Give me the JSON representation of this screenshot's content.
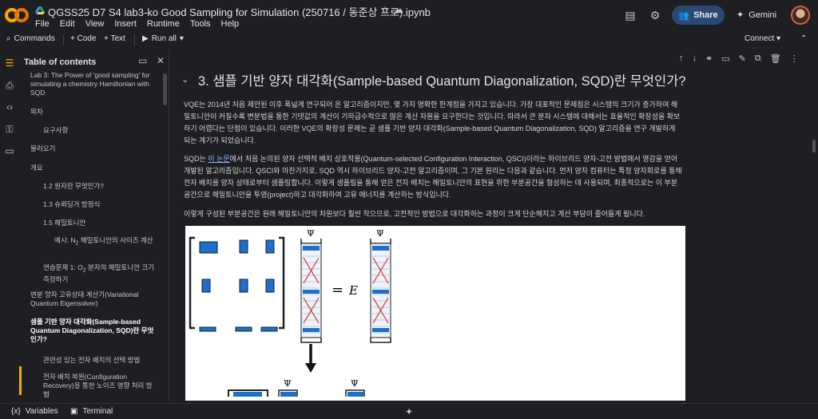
{
  "app": {
    "title": "QGSS25 D7 S4 lab3-ko Good Sampling for Simulation (250716 / 동준상 프로).ipynb",
    "menu": [
      "File",
      "Edit",
      "View",
      "Insert",
      "Runtime",
      "Tools",
      "Help"
    ],
    "share_label": "Share",
    "gemini_label": "Gemini"
  },
  "toolbar": {
    "commands": "Commands",
    "code": "+ Code",
    "text": "+ Text",
    "run_all": "Run all",
    "connect": "Connect"
  },
  "toc": {
    "title": "Table of contents",
    "items": [
      "Lab 3: The Power of 'good sampling' for simulating a chemistry Hamiltonian with SQD",
      "목차",
      "요구사항",
      "불러오기",
      "개요",
      "1.2 원자란 무엇인가?",
      "1.3 슈뢰딩거 방정식",
      "1.5 해밀토니안",
      "예시: N",
      "2",
      "해밀토니안의 사이즈 계산",
      "연습문제 1: O",
      "2",
      "분자의 해밀토니안 크기 측정하기",
      "변분 양자 고유상태 계산기(Variational Quantum Eigensolver)",
      "샘플 기반 양자 대각화(Sample-based Quantum Diagonalization, SQD)란 무엇인가?",
      "관련성 있는 전자 배치의 선택 방법",
      "전자 배치 복원(Configuration Recovery)을 통한 노이즈 영향 처리 방법"
    ]
  },
  "notebook": {
    "heading": "3. 샘플 기반 양자 대각화(Sample-based Quantum Diagonalization, SQD)란 무엇인가?",
    "p1": "VQE는 2014년 처음 제안된 이후 폭넓게 연구되어 온 알고리즘이지만, 몇 가지 명확한 한계점을 가지고 있습니다. 가장 대표적인 문제점은 시스템의 크기가 증가하여 해밀토니안이 커질수록 변분법을 통한 기댓값의 계산이 기하급수적으로 많은 계산 자원을 요구한다는 것입니다. 따라서 큰 분자 시스템에 대해서는 효율적인 확장성을 확보하기 어렵다는 단점이 있습니다. 이러한 VQE의 확장성 문제는 곧 샘플 기반 양자 대각화(Sample-based Quantum Diagonalization, SQD) 알고리즘을 연구 개발하게 되는 계기가 되었습니다.",
    "p2_prefix": "SQD는 ",
    "p2_link": "이 논문",
    "p2_rest": "에서 처음 논의된 양자 선택적 배치 상호작용(Quantum-selected Configuration Interaction, QSCI)이라는 하이브리드 양자-고전 방법에서 영감을 얻어 개발된 알고리즘입니다. QSCI와 마찬가지로, SQD 역시 하이브리드 양자-고전 알고리즘이며, 그 기본 원리는 다음과 같습니다. 먼저 양자 컴퓨터는 특정 양자회로를 통해 전자 배치를 양자 상태로부터 샘플링합니다. 이렇게 샘플링을 통해 얻은 전자 배치는 해밀토니안의 표현을 위한 부분공간을 형성하는 데 사용되며, 최종적으로는 이 부분공간으로 해밀토니안을 투영(project)하고 대각화하여 고유 에너지를 계산하는 방식입니다.",
    "p3": "이렇게 구성된 부분공간은 원래 해밀토니안의 차원보다 훨씬 작으므로, 고전적인 방법으로 대각화하는 과정이 크게 단순해지고 계산 부담이 줄어들게 됩니다.",
    "figure": {
      "psi": "Ψ",
      "equals": "=",
      "energy": "E"
    }
  },
  "footer": {
    "variables": "Variables",
    "terminal": "Terminal"
  }
}
